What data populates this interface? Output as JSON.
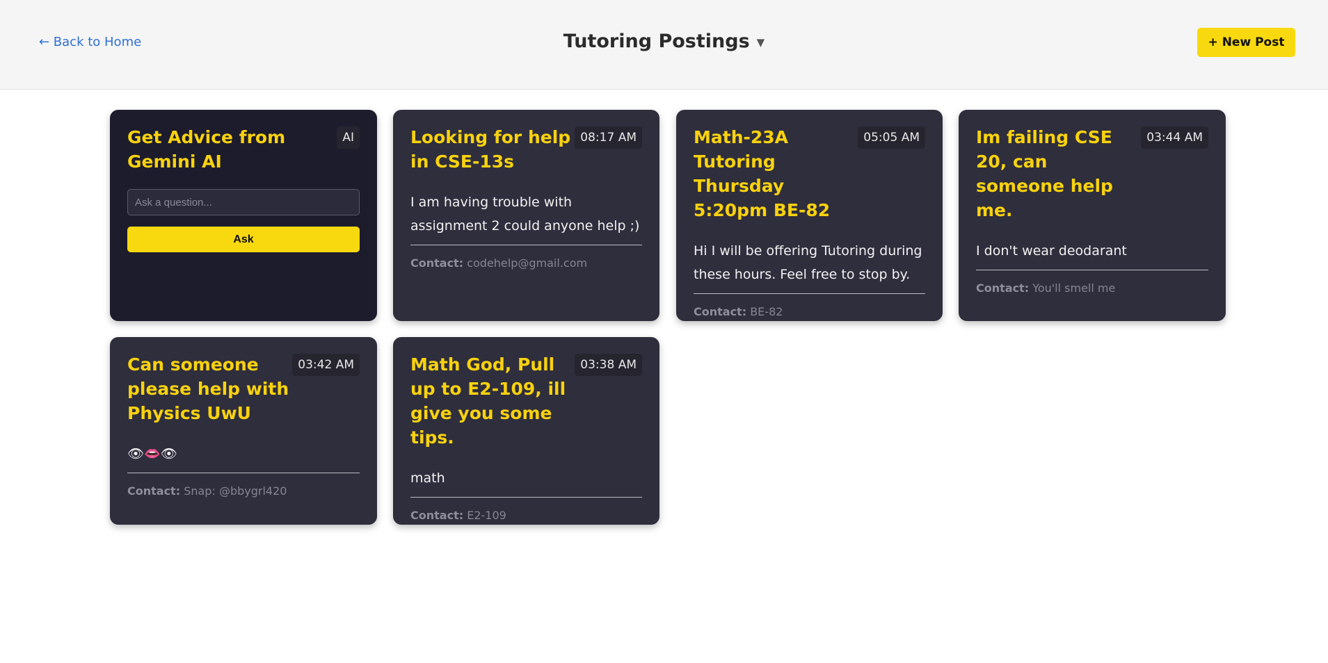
{
  "header": {
    "back_label": "← Back to Home",
    "title": "Tutoring Postings",
    "dropdown_icon": "▼",
    "new_post_label": "+ New Post"
  },
  "ai_card": {
    "title": "Get Advice from Gemini AI",
    "badge": "AI",
    "input_placeholder": "Ask a question...",
    "input_value": "",
    "ask_label": "Ask"
  },
  "contact_label": "Contact:",
  "posts": [
    {
      "title": "Looking for help in CSE-13s",
      "time": "08:17 AM",
      "body": "I am having trouble with assignment 2 could anyone help ;)",
      "contact": "codehelp@gmail.com"
    },
    {
      "title": "Math-23A Tutoring Thursday 5:20pm BE-82",
      "time": "05:05 AM",
      "body": "Hi I will be offering Tutoring during these hours. Feel free to stop by.",
      "contact": "BE-82"
    },
    {
      "title": "Im failing CSE 20, can someone help me.",
      "time": "03:44 AM",
      "body": "I don't wear deodarant",
      "contact": "You'll smell me"
    },
    {
      "title": "Can someone please help with Physics UwU",
      "time": "03:42 AM",
      "body": "👁👄👁",
      "contact": "Snap: @bbygrl420"
    },
    {
      "title": "Math God, Pull up to E2-109, ill give you some tips.",
      "time": "03:38 AM",
      "body": "math",
      "contact": "E2-109"
    }
  ],
  "colors": {
    "accent": "#f8d90f",
    "card": "#2f2e3d",
    "ai_card": "#1d1c2d",
    "link": "#2f6fd6"
  }
}
